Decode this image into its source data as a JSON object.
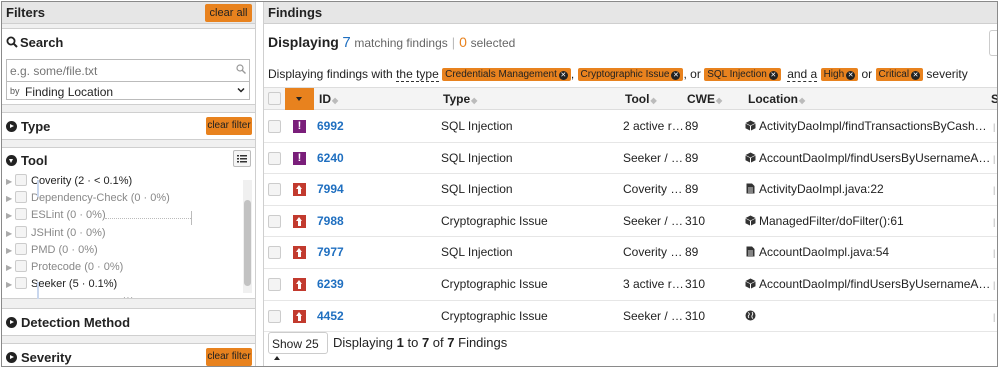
{
  "filters": {
    "title": "Filters",
    "clear_all": "clear all",
    "search": {
      "title": "Search",
      "placeholder": "e.g. some/file.txt",
      "by_label": "by",
      "by_value": "Finding Location"
    },
    "type": {
      "title": "Type",
      "clear_label": "clear filter"
    },
    "tool": {
      "title": "Tool",
      "items": [
        {
          "name": "Coverity",
          "count": "(2 · < 0.1%)",
          "active": true
        },
        {
          "name": "Dependency-Check",
          "count": "(0 · 0%)",
          "active": false
        },
        {
          "name": "ESLint",
          "count": "(0 · 0%)",
          "active": false
        },
        {
          "name": "JSHint",
          "count": "(0 · 0%)",
          "active": false
        },
        {
          "name": "PMD",
          "count": "(0 · 0%)",
          "active": false
        },
        {
          "name": "Protecode",
          "count": "(0 · 0%)",
          "active": false
        },
        {
          "name": "Seeker",
          "count": "(5 · 0.1%)",
          "active": true
        }
      ]
    },
    "detection": {
      "title": "Detection Method"
    },
    "severity": {
      "title": "Severity",
      "clear_label": "clear filter"
    }
  },
  "findings": {
    "title": "Findings",
    "displaying_label": "Displaying",
    "matching_count": "7",
    "matching_label": "matching findings",
    "selected_count": "0",
    "selected_label": "selected",
    "filter_prefix": "Displaying findings with",
    "filter_the_type": "the type",
    "type_chips": [
      "Credentials Management",
      "Cryptographic Issue",
      "SQL Injection"
    ],
    "comma": ",",
    "or": "or",
    "and_a": "and a",
    "severity_chips": [
      "High",
      "Critical"
    ],
    "severity_word": "severity",
    "columns": {
      "id": "ID",
      "type": "Type",
      "tool": "Tool",
      "cwe": "CWE",
      "location": "Location",
      "last": "S"
    },
    "rows": [
      {
        "severity": "critical",
        "id": "6992",
        "type": "SQL Injection",
        "tool": "2 active re...",
        "tool_underline": true,
        "cwe": "89",
        "loc_icon": "cube-icon",
        "location": "ActivityDaoImpl/findTransactionsByCashAc..."
      },
      {
        "severity": "critical",
        "id": "6240",
        "type": "SQL Injection",
        "tool": "Seeker / S...",
        "tool_underline": false,
        "cwe": "89",
        "loc_icon": "cube-icon",
        "location": "AccountDaoImpl/findUsersByUsernameAnd..."
      },
      {
        "severity": "high",
        "id": "7994",
        "type": "SQL Injection",
        "tool": "Coverity / ...",
        "tool_underline": false,
        "cwe": "89",
        "loc_icon": "file-icon",
        "location": "ActivityDaoImpl.java:22"
      },
      {
        "severity": "high",
        "id": "7988",
        "type": "Cryptographic Issue",
        "tool": "Seeker / S...",
        "tool_underline": false,
        "cwe": "310",
        "loc_icon": "cube-icon",
        "location": "ManagedFilter/doFilter():61"
      },
      {
        "severity": "high",
        "id": "7977",
        "type": "SQL Injection",
        "tool": "Coverity / ...",
        "tool_underline": false,
        "cwe": "89",
        "loc_icon": "file-icon",
        "location": "AccountDaoImpl.java:54"
      },
      {
        "severity": "high",
        "id": "6239",
        "type": "Cryptographic Issue",
        "tool": "3 active re...",
        "tool_underline": true,
        "cwe": "310",
        "loc_icon": "cube-icon",
        "location": "AccountDaoImpl/findUsersByUsernameAnd..."
      },
      {
        "severity": "high",
        "id": "4452",
        "type": "Cryptographic Issue",
        "tool": "Seeker / In...",
        "tool_underline": false,
        "cwe": "310",
        "loc_icon": "globe-icon",
        "location": ""
      }
    ],
    "show_label": "Show 25",
    "footer": {
      "prefix": "Displaying",
      "from": "1",
      "to_word": "to",
      "to": "7",
      "of_word": "of",
      "total": "7",
      "suffix": "Findings"
    }
  },
  "colors": {
    "accent": "#e8821e",
    "link": "#1f6fc0",
    "critical": "#7a1e7a",
    "high": "#c23a2e"
  }
}
